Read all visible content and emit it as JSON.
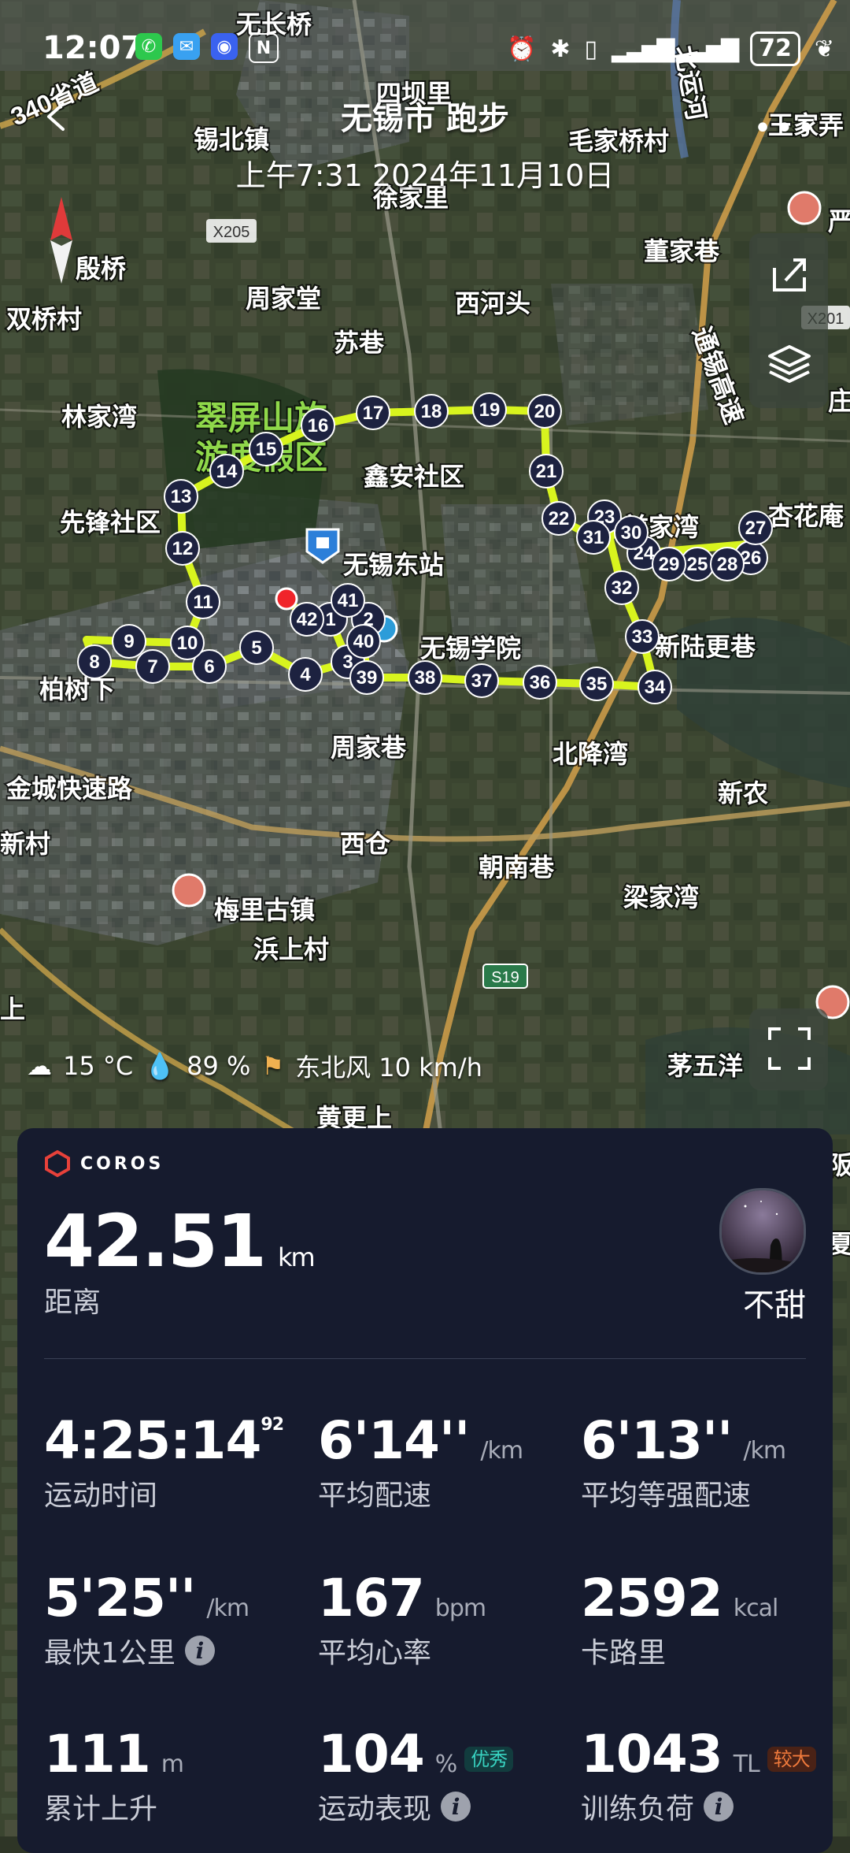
{
  "status_bar": {
    "time": "12:07",
    "battery": "72"
  },
  "header": {
    "title": "无锡市 跑步",
    "subtitle": "上午7:31 2024年11月10日"
  },
  "map": {
    "labels": [
      "无长桥",
      "四坝里",
      "锡北镇",
      "毛家桥村",
      "王家弄",
      "徐家里",
      "董家巷",
      "殷桥",
      "周家堂",
      "西河头",
      "双桥村",
      "苏巷",
      "翠屏山旅",
      "游度假区",
      "林家湾",
      "鑫安社区",
      "杏花庵",
      "先锋社区",
      "前家湾",
      "无锡东站",
      "无锡学院",
      "新陆更巷",
      "柏树下",
      "周家巷",
      "北降湾",
      "新农",
      "金城快速路",
      "新村",
      "西仓",
      "朝南巷",
      "梁家湾",
      "梅里古镇",
      "浜上村",
      "茅五洋",
      "黄更上",
      "严",
      "庄",
      "阪",
      "夏",
      "上"
    ],
    "road_badges": [
      "X205",
      "X201",
      "S19"
    ],
    "road_names": [
      "340省道",
      "通锡高速",
      "北运河"
    ],
    "markers": [
      "1",
      "2",
      "3",
      "4",
      "5",
      "6",
      "7",
      "8",
      "9",
      "10",
      "11",
      "12",
      "13",
      "14",
      "15",
      "16",
      "17",
      "18",
      "19",
      "20",
      "21",
      "22",
      "23",
      "24",
      "25",
      "26",
      "27",
      "28",
      "29",
      "30",
      "31",
      "32",
      "33",
      "34",
      "35",
      "36",
      "37",
      "38",
      "39",
      "40",
      "41",
      "42"
    ],
    "route_color": "#d8f41e",
    "marker_color": "#1d2240"
  },
  "weather": {
    "temp": "15 °C",
    "humidity": "89 %",
    "wind": "东北风 10 km/h"
  },
  "card": {
    "brand": "COROS",
    "distance": "42.51",
    "distance_unit": "km",
    "distance_label": "距离",
    "user_name": "不甜",
    "stats": {
      "time": {
        "value": "4:25:14",
        "sup": "92",
        "label": "运动时间"
      },
      "avg_pace": {
        "value": "6'14''",
        "unit": "/km",
        "label": "平均配速"
      },
      "gap": {
        "value": "6'13''",
        "unit": "/km",
        "label": "平均等强配速"
      },
      "fastest_km": {
        "value": "5'25''",
        "unit": "/km",
        "label": "最快1公里"
      },
      "heart_rate": {
        "value": "167",
        "unit": "bpm",
        "label": "平均心率"
      },
      "calories": {
        "value": "2592",
        "unit": "kcal",
        "label": "卡路里"
      },
      "elevation": {
        "value": "111",
        "unit": "m",
        "label": "累计上升"
      },
      "performance": {
        "value": "104",
        "unit": "%",
        "badge": "优秀",
        "label": "运动表现"
      },
      "training_load": {
        "value": "1043",
        "unit": "TL",
        "badge": "较大",
        "label": "训练负荷"
      }
    }
  }
}
